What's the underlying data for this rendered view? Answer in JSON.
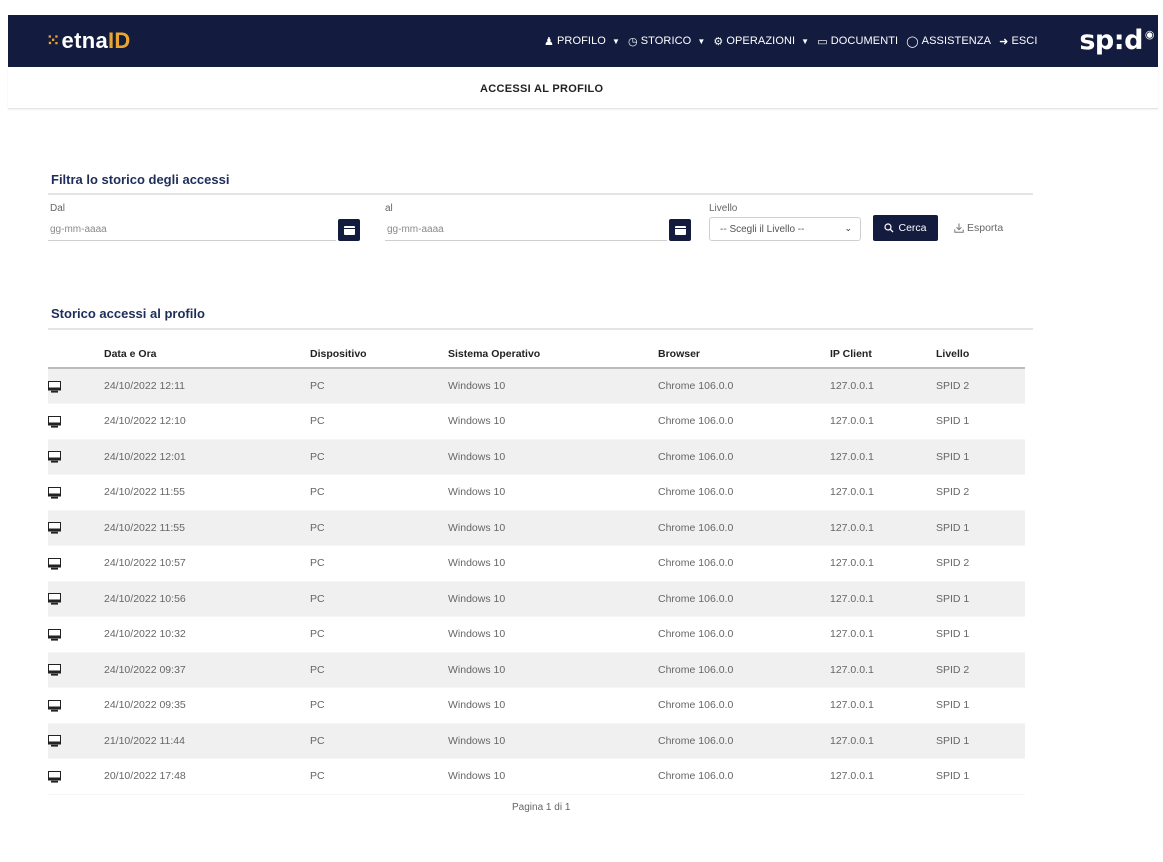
{
  "app": {
    "logo_prefix": "etna",
    "logo_suffix": "ID",
    "spid_brand": "sp",
    "spid_brand_tail": "d"
  },
  "nav": {
    "items": [
      {
        "label": "PROFILO",
        "icon": "user-icon",
        "dropdown": true
      },
      {
        "label": "STORICO",
        "icon": "clock-icon",
        "dropdown": true
      },
      {
        "label": "OPERAZIONI",
        "icon": "gear-icon",
        "dropdown": true
      },
      {
        "label": "DOCUMENTI",
        "icon": "document-icon",
        "dropdown": false
      },
      {
        "label": "ASSISTENZA",
        "icon": "headset-icon",
        "dropdown": false
      },
      {
        "label": "ESCI",
        "icon": "logout-icon",
        "dropdown": false
      }
    ]
  },
  "page": {
    "title": "ACCESSI AL PROFILO"
  },
  "filter": {
    "title": "Filtra lo storico degli accessi",
    "from_label": "Dal",
    "from_placeholder": "gg-mm-aaaa",
    "to_label": "al",
    "to_placeholder": "gg-mm-aaaa",
    "level_label": "Livello",
    "level_selected": "-- Scegli il Livello --",
    "search_label": "Cerca",
    "export_label": "Esporta"
  },
  "history": {
    "title": "Storico accessi al profilo",
    "columns": [
      "Data e Ora",
      "Dispositivo",
      "Sistema Operativo",
      "Browser",
      "IP Client",
      "Livello"
    ],
    "rows": [
      [
        "24/10/2022  12:11",
        "PC",
        "Windows 10",
        "Chrome 106.0.0",
        "127.0.0.1",
        "SPID 2"
      ],
      [
        "24/10/2022  12:10",
        "PC",
        "Windows 10",
        "Chrome 106.0.0",
        "127.0.0.1",
        "SPID 1"
      ],
      [
        "24/10/2022  12:01",
        "PC",
        "Windows 10",
        "Chrome 106.0.0",
        "127.0.0.1",
        "SPID 1"
      ],
      [
        "24/10/2022  11:55",
        "PC",
        "Windows 10",
        "Chrome 106.0.0",
        "127.0.0.1",
        "SPID 2"
      ],
      [
        "24/10/2022  11:55",
        "PC",
        "Windows 10",
        "Chrome 106.0.0",
        "127.0.0.1",
        "SPID 1"
      ],
      [
        "24/10/2022  10:57",
        "PC",
        "Windows 10",
        "Chrome 106.0.0",
        "127.0.0.1",
        "SPID 2"
      ],
      [
        "24/10/2022  10:56",
        "PC",
        "Windows 10",
        "Chrome 106.0.0",
        "127.0.0.1",
        "SPID 1"
      ],
      [
        "24/10/2022  10:32",
        "PC",
        "Windows 10",
        "Chrome 106.0.0",
        "127.0.0.1",
        "SPID 1"
      ],
      [
        "24/10/2022  09:37",
        "PC",
        "Windows 10",
        "Chrome 106.0.0",
        "127.0.0.1",
        "SPID 2"
      ],
      [
        "24/10/2022  09:35",
        "PC",
        "Windows 10",
        "Chrome 106.0.0",
        "127.0.0.1",
        "SPID 1"
      ],
      [
        "21/10/2022  11:44",
        "PC",
        "Windows 10",
        "Chrome 106.0.0",
        "127.0.0.1",
        "SPID 1"
      ],
      [
        "20/10/2022  17:48",
        "PC",
        "Windows 10",
        "Chrome 106.0.0",
        "127.0.0.1",
        "SPID 1"
      ]
    ],
    "row_icon": "computer-icon",
    "pagination": "Pagina 1 di 1"
  },
  "colors": {
    "navbar": "#131c3f",
    "accent": "#e8a630",
    "section_title": "#1e2d5a"
  }
}
